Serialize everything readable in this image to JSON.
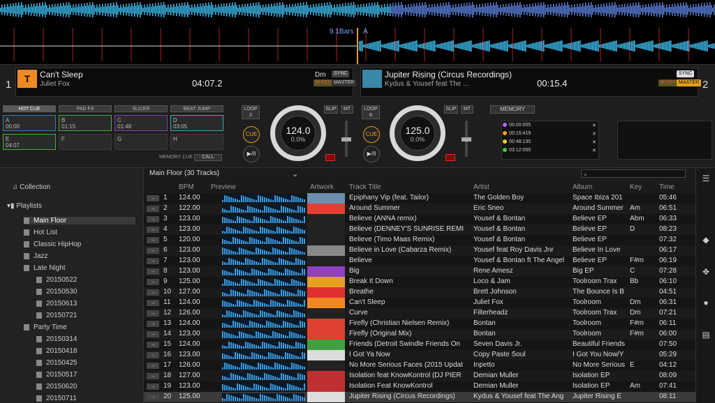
{
  "waveform": {
    "bars_label": "9.1Bars",
    "marker": "A"
  },
  "deck1": {
    "number": "1",
    "title": "Can't Sleep",
    "artist": "Juliet Fox",
    "time": "04:07.2",
    "key": "Dm",
    "sync": "SYNC",
    "master": "MASTER",
    "mkey": "M-KEY",
    "tabs": [
      "HOT CUE",
      "PAD FX",
      "SLICER",
      "BEAT JUMP"
    ],
    "pads": [
      {
        "l": "A",
        "t": "00:00"
      },
      {
        "l": "B",
        "t": "01:15"
      },
      {
        "l": "C",
        "t": "01:48"
      },
      {
        "l": "D",
        "t": "03:05"
      },
      {
        "l": "E",
        "t": "04:07"
      },
      {
        "l": "F",
        "t": ""
      },
      {
        "l": "G",
        "t": ""
      },
      {
        "l": "H",
        "t": ""
      }
    ],
    "loop_label": "LOOP",
    "loop_val": "2",
    "cue": "CUE",
    "play": "▶/II",
    "slip": "SLIP",
    "mt": "MT",
    "bpm": "124.0",
    "pitch": "0.0%",
    "memory_cue": "MEMORY CUE",
    "call": "CALL"
  },
  "deck2": {
    "number": "2",
    "title": "Jupiter Rising (Circus Recordings)",
    "artist": "Kydus & Yousef feat The ...",
    "time": "00:15.4",
    "sync": "SYNC",
    "master": "MASTER",
    "mkey": "M-KEY",
    "loop_label": "LOOP",
    "loop_val": "8",
    "cue": "CUE",
    "play": "▶/II",
    "slip": "SLIP",
    "mt": "MT",
    "bpm": "125.0",
    "pitch": "0.0%",
    "memory": "MEMORY",
    "memcues": [
      {
        "t": "00:00:055",
        "c": "#c060ff"
      },
      {
        "t": "00:15:419",
        "c": "#ff9a2a"
      },
      {
        "t": "00:48:135",
        "c": "#e6d020"
      },
      {
        "t": "03:12:055",
        "c": "#3ad03a"
      }
    ]
  },
  "tree": {
    "collection": "Collection",
    "playlists": "Playlists",
    "items": [
      "Main Floor",
      "Hot List",
      "Classic HipHop",
      "Jazz",
      "Late Night",
      "20150522",
      "20150530",
      "20150613",
      "20150721",
      "Party Time",
      "20150314",
      "20150418",
      "20150425",
      "20150517",
      "20150620",
      "20150711"
    ]
  },
  "list": {
    "header": "Main Floor (30 Tracks)",
    "cols": [
      "BPM",
      "Preview",
      "Artwork",
      "Track Title",
      "Artist",
      "Album",
      "Key",
      "Time"
    ],
    "rows": [
      {
        "n": "1",
        "bpm": "124.00",
        "t": "Epiphany Vip (feat. Tailor)",
        "a": "The Golden Boy",
        "al": "Space Ibiza 201",
        "k": "",
        "tm": "05:46",
        "art": "#6a8fb0"
      },
      {
        "n": "2",
        "bpm": "122.00",
        "t": "Around Summer",
        "a": "Eric Sneo",
        "al": "Around Summer",
        "k": "Am",
        "tm": "06:51",
        "art": "#e04030"
      },
      {
        "n": "3",
        "bpm": "123.00",
        "t": "Believe (ANNA remix)",
        "a": "Yousef & Bontan",
        "al": "Believe EP",
        "k": "Abm",
        "tm": "06:33",
        "art": "#222"
      },
      {
        "n": "4",
        "bpm": "123.00",
        "t": "Believe (DENNEY'S SUNRISE REMI",
        "a": "Yousef & Bontan",
        "al": "Believe EP",
        "k": "D",
        "tm": "08:23",
        "art": "#222"
      },
      {
        "n": "5",
        "bpm": "120.00",
        "t": "Believe (Timo Maas Remix)",
        "a": "Yousef & Bontan",
        "al": "Believe EP",
        "k": "",
        "tm": "07:32",
        "art": "#222"
      },
      {
        "n": "6",
        "bpm": "123.00",
        "t": "Believe in Love (Cabarza Remix)",
        "a": "Yousef feat Roy Davis Jnr",
        "al": "Believe In Love",
        "k": "",
        "tm": "06:17",
        "art": "#888"
      },
      {
        "n": "7",
        "bpm": "123.00",
        "t": "Believe",
        "a": "Yousef & Bontan ft The Angel",
        "al": "Believe EP",
        "k": "F#m",
        "tm": "06:19",
        "art": "#222"
      },
      {
        "n": "8",
        "bpm": "123.00",
        "t": "Big",
        "a": "Rene Amesz",
        "al": "Big EP",
        "k": "C",
        "tm": "07:28",
        "art": "#9040c0"
      },
      {
        "n": "9",
        "bpm": "125.00",
        "t": "Break It Down",
        "a": "Loco & Jam",
        "al": "Toolroom Trax",
        "k": "Bb",
        "tm": "06:10",
        "art": "#e6a020"
      },
      {
        "n": "10",
        "bpm": "127.00",
        "t": "Breathe",
        "a": "Brett Johnson",
        "al": "The Bounce Is B",
        "k": "",
        "tm": "04:51",
        "art": "#e03030"
      },
      {
        "n": "11",
        "bpm": "124.00",
        "t": "Can't Sleep",
        "a": "Juliet Fox",
        "al": "Toolroom",
        "k": "Dm",
        "tm": "06:31",
        "art": "#f08a20"
      },
      {
        "n": "12",
        "bpm": "126.00",
        "t": "Curve",
        "a": "Filterheadz",
        "al": "Toolroom Trax",
        "k": "Dm",
        "tm": "07:21",
        "art": "#222"
      },
      {
        "n": "13",
        "bpm": "124.00",
        "t": "Firefly (Christian Nielsen Remix)",
        "a": "Bontan",
        "al": "Toolroom",
        "k": "F#m",
        "tm": "06:11",
        "art": "#e04030"
      },
      {
        "n": "14",
        "bpm": "123.00",
        "t": "Firefly (Original Mix)",
        "a": "Bontan",
        "al": "Toolroom",
        "k": "F#m",
        "tm": "06:00",
        "art": "#e04030"
      },
      {
        "n": "15",
        "bpm": "124.00",
        "t": "Friends (Detroit Swindle Friends On",
        "a": "Seven Davis Jr.",
        "al": "Beautiful Friends",
        "k": "",
        "tm": "07:50",
        "art": "#40a040"
      },
      {
        "n": "16",
        "bpm": "123.00",
        "t": "I Got Ya Now",
        "a": "Copy Paste Soul",
        "al": "I Got You Now/Y",
        "k": "",
        "tm": "05:29",
        "art": "#ddd"
      },
      {
        "n": "17",
        "bpm": "126.00",
        "t": "No More Serious Faces (2015 Updat",
        "a": "Inpetto",
        "al": "No More Serious",
        "k": "E",
        "tm": "04:12",
        "art": "#222"
      },
      {
        "n": "18",
        "bpm": "127.00",
        "t": "Isolation feat KnowKontrol (DJ PIER",
        "a": "Demian Muller",
        "al": "Isolation EP",
        "k": "",
        "tm": "08:09",
        "art": "#c03030"
      },
      {
        "n": "19",
        "bpm": "123.00",
        "t": "Isolation Feat KnowKontrol",
        "a": "Demian Muller",
        "al": "Isolation EP",
        "k": "Am",
        "tm": "07:41",
        "art": "#c03030"
      },
      {
        "n": "20",
        "bpm": "125.00",
        "t": "Jupiter Rising (Circus Recordings)",
        "a": "Kydus & Yousef feat The Ang",
        "al": "Jupiter Rising E",
        "k": "",
        "tm": "08:11",
        "art": "#ddd"
      }
    ]
  },
  "colors": {
    "accent": "#e6a020",
    "wave": "#3ab8e8"
  }
}
